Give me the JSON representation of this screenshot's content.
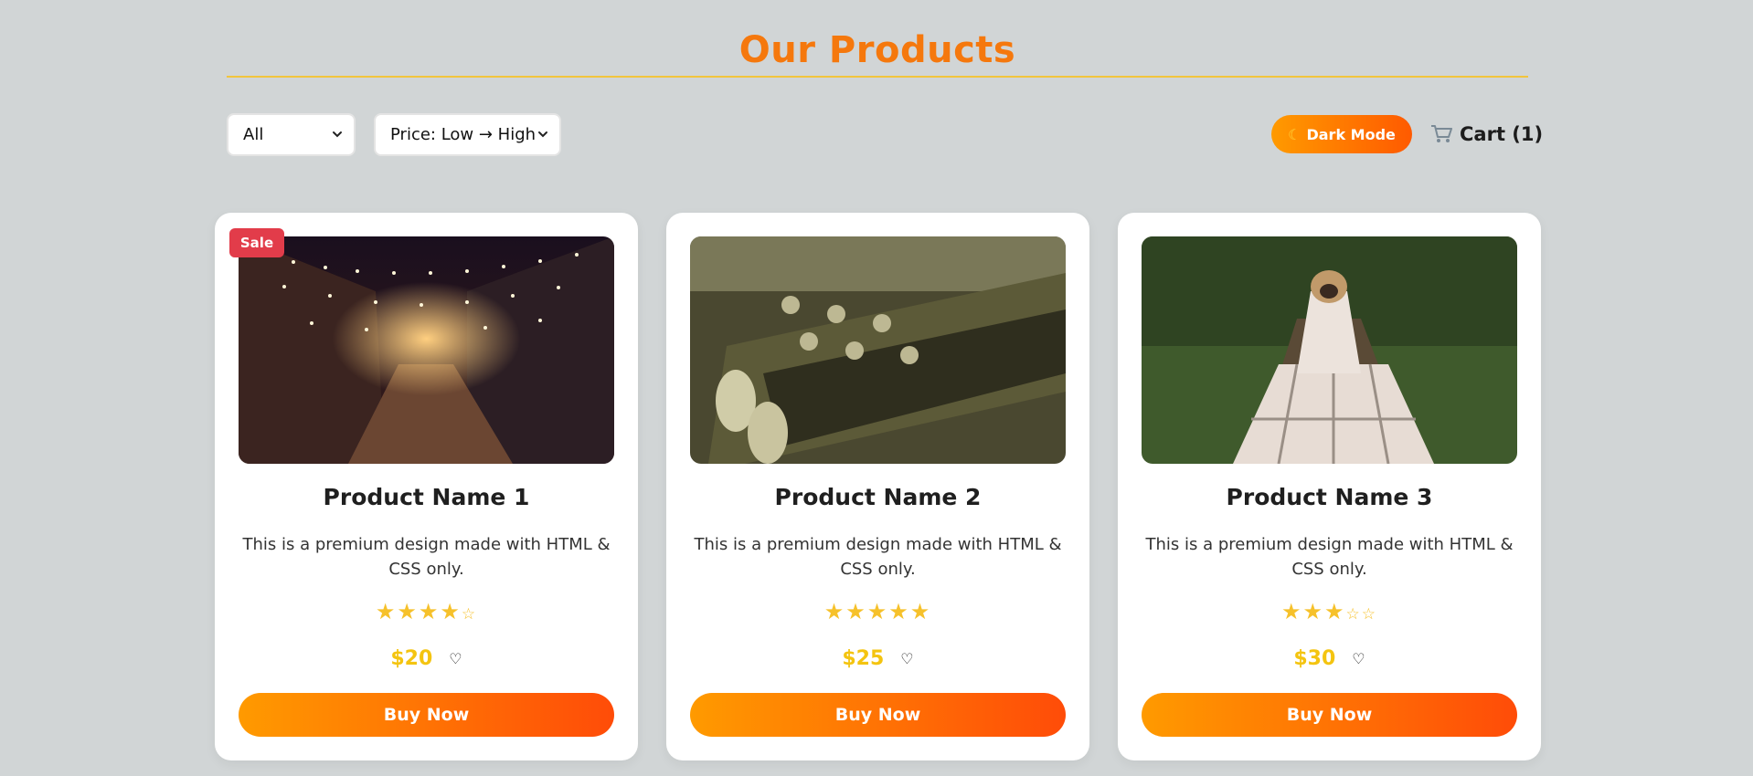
{
  "header": {
    "title": "Our Products"
  },
  "toolbar": {
    "category_select": "All",
    "sort_select": "Price: Low → High",
    "dark_mode_label": "Dark Mode",
    "cart_label": "Cart (1)"
  },
  "colors": {
    "accent": "#f5780d",
    "price": "#f4c410",
    "badge": "#e23c4a",
    "background": "#d1d5d6"
  },
  "products": [
    {
      "name": "Product Name 1",
      "description": "This is a premium design made with HTML & CSS only.",
      "rating": 4,
      "rating_max": 5,
      "price": "$20",
      "badge": "Sale",
      "button": "Buy Now",
      "image": "street-lights-photo"
    },
    {
      "name": "Product Name 2",
      "description": "This is a premium design made with HTML & CSS only.",
      "rating": 5,
      "rating_max": 5,
      "price": "$25",
      "badge": "",
      "button": "Buy Now",
      "image": "guitar-headstock-photo"
    },
    {
      "name": "Product Name 3",
      "description": "This is a premium design made with HTML & CSS only.",
      "rating": 3,
      "rating_max": 5,
      "price": "$30",
      "badge": "",
      "button": "Buy Now",
      "image": "pug-blanket-photo"
    }
  ]
}
